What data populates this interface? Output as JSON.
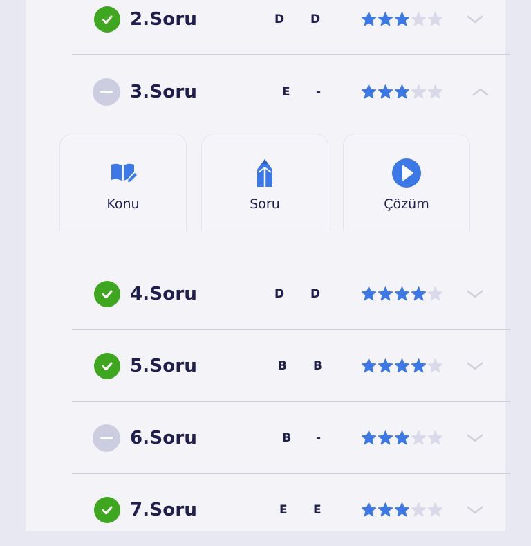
{
  "questions": [
    {
      "label": "2.Soru",
      "status": "correct",
      "user_answer": "D",
      "correct_answer": "D",
      "rating": 3,
      "max_rating": 5,
      "expanded": false
    },
    {
      "label": "3.Soru",
      "status": "empty",
      "user_answer": "E",
      "correct_answer": "-",
      "rating": 3,
      "max_rating": 5,
      "expanded": true
    },
    {
      "label": "4.Soru",
      "status": "correct",
      "user_answer": "D",
      "correct_answer": "D",
      "rating": 4,
      "max_rating": 5,
      "expanded": false
    },
    {
      "label": "5.Soru",
      "status": "correct",
      "user_answer": "B",
      "correct_answer": "B",
      "rating": 4,
      "max_rating": 5,
      "expanded": false
    },
    {
      "label": "6.Soru",
      "status": "empty",
      "user_answer": "B",
      "correct_answer": "-",
      "rating": 3,
      "max_rating": 5,
      "expanded": false
    },
    {
      "label": "7.Soru",
      "status": "correct",
      "user_answer": "E",
      "correct_answer": "E",
      "rating": 3,
      "max_rating": 5,
      "expanded": false
    }
  ],
  "expanded_actions": [
    {
      "label": "Konu",
      "icon": "book-edit-icon"
    },
    {
      "label": "Soru",
      "icon": "pencil-icon"
    },
    {
      "label": "Çözüm",
      "icon": "play-circle-icon"
    }
  ],
  "colors": {
    "correct": "#3ea61f",
    "empty": "#cdcde2",
    "star_filled": "#3c78e6",
    "star_empty": "#d9d9ea",
    "accent": "#3c78e6",
    "text": "#1f1e4d"
  }
}
